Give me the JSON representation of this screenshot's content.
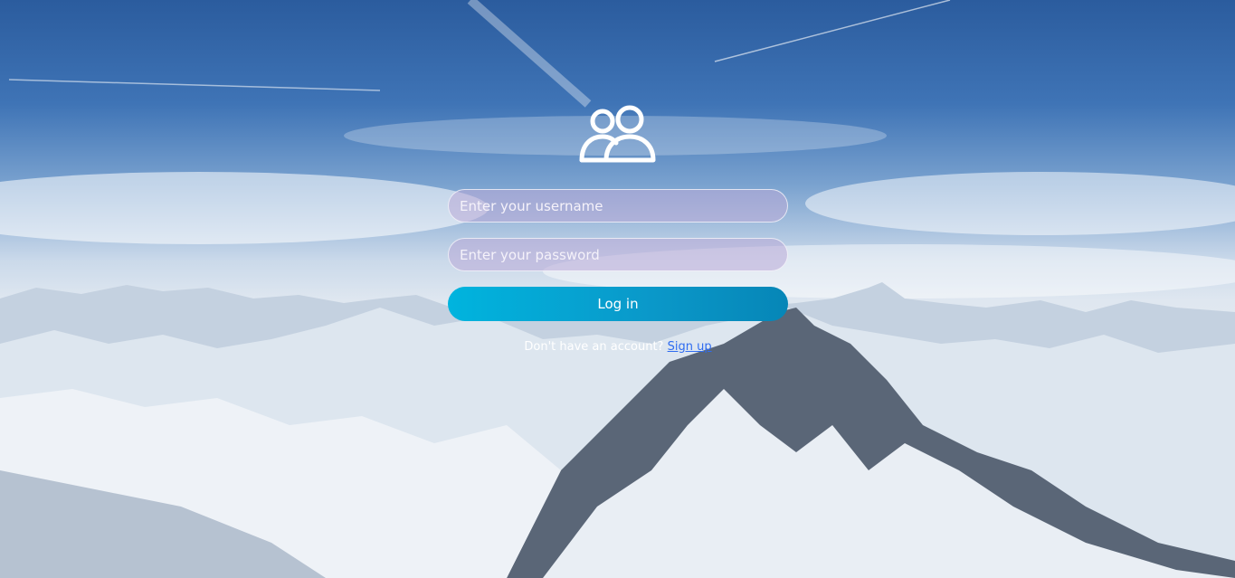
{
  "login": {
    "avatar_icon": "users-icon",
    "username_placeholder": "Enter your username",
    "password_placeholder": "Enter your password",
    "login_label": "Log in",
    "signup_prompt": "Don't have an account?",
    "signup_link": "Sign up"
  },
  "colors": {
    "button_start": "#00b4de",
    "button_end": "#0686b7",
    "link": "#2f6cf0"
  }
}
